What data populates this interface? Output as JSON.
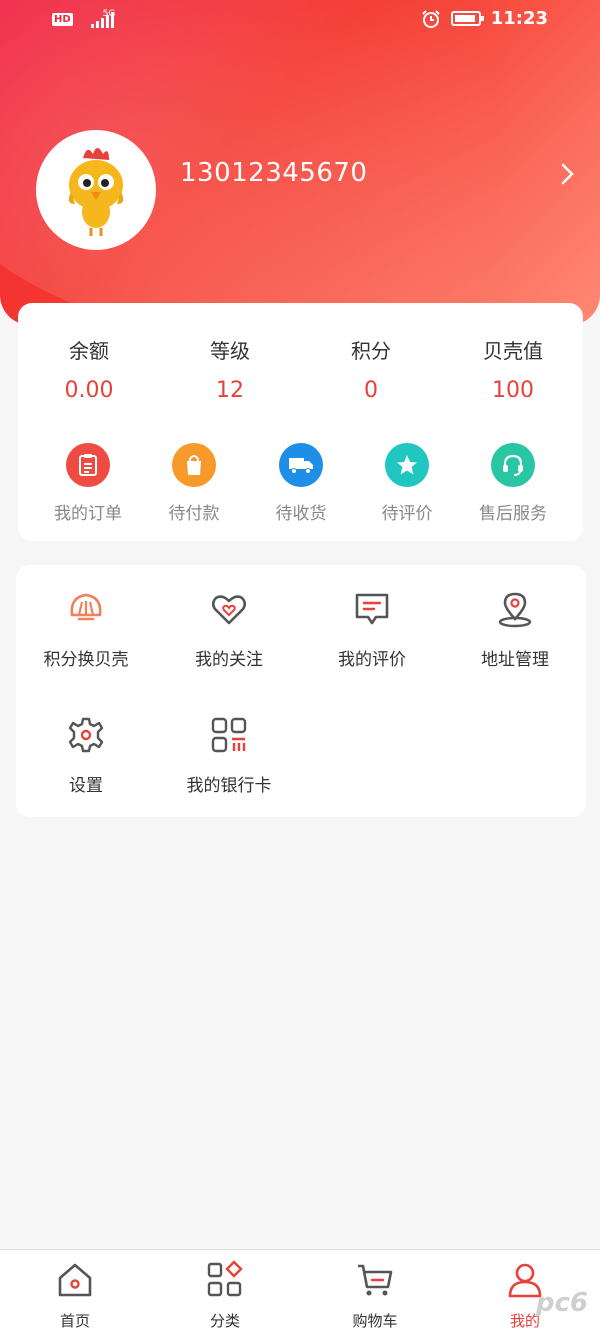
{
  "status_bar": {
    "hd": "HD",
    "net": "5G",
    "time": "11:23"
  },
  "profile": {
    "phone": "13012345670"
  },
  "account_stats": [
    {
      "label": "余额",
      "value": "0.00"
    },
    {
      "label": "等级",
      "value": "12"
    },
    {
      "label": "积分",
      "value": "0"
    },
    {
      "label": "贝壳值",
      "value": "100"
    }
  ],
  "orders": [
    {
      "label": "我的订单",
      "icon": "clipboard-icon",
      "color": "#ee4b43"
    },
    {
      "label": "待付款",
      "icon": "shopping-bag-icon",
      "color": "#f79a2a"
    },
    {
      "label": "待收货",
      "icon": "truck-icon",
      "color": "#1e8ee6"
    },
    {
      "label": "待评价",
      "icon": "star-icon",
      "color": "#22c6c0"
    },
    {
      "label": "售后服务",
      "icon": "headset-icon",
      "color": "#29c6a4"
    }
  ],
  "services": [
    {
      "label": "积分换贝壳",
      "icon": "shell-icon"
    },
    {
      "label": "我的关注",
      "icon": "heart-icon"
    },
    {
      "label": "我的评价",
      "icon": "comment-icon"
    },
    {
      "label": "地址管理",
      "icon": "location-icon"
    },
    {
      "label": "设置",
      "icon": "gear-icon"
    },
    {
      "label": "我的银行卡",
      "icon": "bank-card-icon"
    }
  ],
  "tabs": [
    {
      "label": "首页",
      "icon": "home-icon"
    },
    {
      "label": "分类",
      "icon": "category-icon"
    },
    {
      "label": "购物车",
      "icon": "cart-icon"
    },
    {
      "label": "我的",
      "icon": "user-icon",
      "active": true
    }
  ],
  "watermark": "pc6",
  "colors": {
    "accent": "#e8413a",
    "hero_start": "#f01e3f",
    "hero_end": "#ff8a74"
  }
}
